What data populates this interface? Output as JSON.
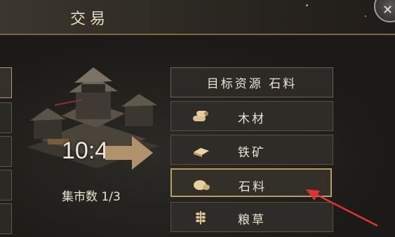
{
  "header": {
    "title": "交易"
  },
  "trade": {
    "ratio": "10:4",
    "market_count": "集市数 1/3"
  },
  "resources": {
    "header_label": "目标资源 石料",
    "items": [
      {
        "label": "木材",
        "icon": "wood-icon",
        "selected": false
      },
      {
        "label": "铁矿",
        "icon": "iron-ingot-icon",
        "selected": false
      },
      {
        "label": "石料",
        "icon": "stone-icon",
        "selected": true
      },
      {
        "label": "粮草",
        "icon": "grain-icon",
        "selected": false
      }
    ]
  },
  "colors": {
    "accent_gold": "#b99c5f",
    "annotation_red": "#e03232",
    "text": "#ebe3d2"
  }
}
